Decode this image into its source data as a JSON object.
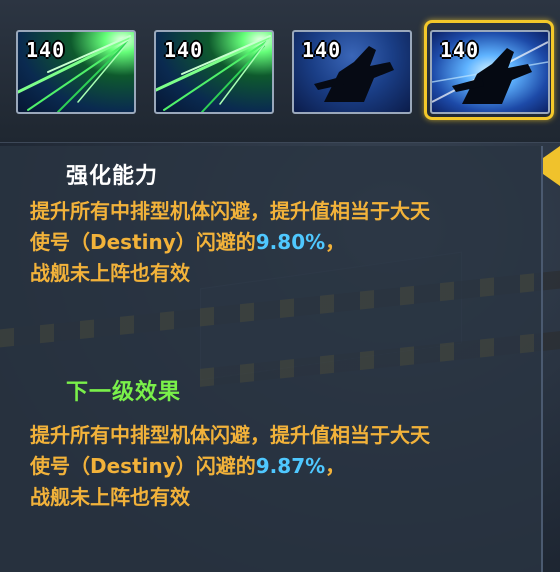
{
  "skills": [
    {
      "level": "140",
      "selected": false,
      "icon": "green-beams-icon"
    },
    {
      "level": "140",
      "selected": false,
      "icon": "green-beams-icon"
    },
    {
      "level": "140",
      "selected": false,
      "icon": "ship-silhouette-icon"
    },
    {
      "level": "140",
      "selected": true,
      "icon": "ship-silhouette-icon"
    }
  ],
  "current": {
    "title": "强化能力",
    "line1": "提升所有中排型机体闪避，提升值相当于大天",
    "line2_prefix": "使号（Destiny）闪避的",
    "line2_value": "9.80%",
    "line2_suffix": "，",
    "line3": "战舰未上阵也有效"
  },
  "next": {
    "title": "下一级效果",
    "line1": "提升所有中排型机体闪避，提升值相当于大天",
    "line2_prefix": "使号（Destiny）闪避的",
    "line2_value": "9.87%",
    "line2_suffix": "，",
    "line3": "战舰未上阵也有效"
  },
  "colors": {
    "desc_text": "#f2b23a",
    "value_text": "#4fc8ff",
    "next_title": "#7af04a",
    "selected_frame": "#f4c82a"
  }
}
